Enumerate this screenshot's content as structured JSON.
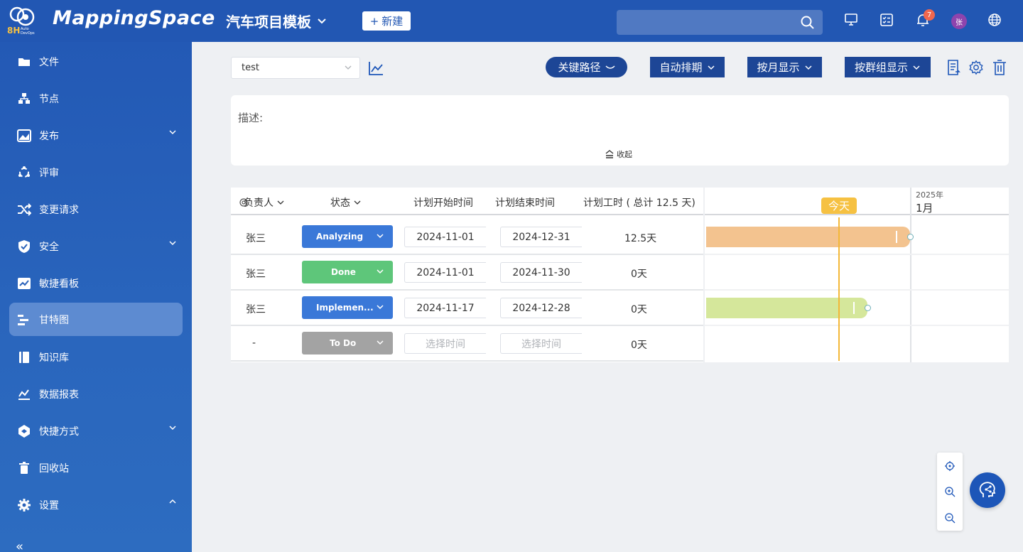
{
  "app": {
    "logo_text": "MappingSpace",
    "logo_sub": "8H",
    "logo_sub2": "Auto DevOps",
    "project_title": "汽车项目模板",
    "new_button": "新建",
    "notification_count": "7",
    "avatar_initial": "张"
  },
  "sidebar": {
    "items": [
      {
        "label": "文件",
        "icon": "folder-icon"
      },
      {
        "label": "节点",
        "icon": "node-icon"
      },
      {
        "label": "发布",
        "icon": "release-icon"
      },
      {
        "label": "评审",
        "icon": "review-icon"
      },
      {
        "label": "变更请求",
        "icon": "shuffle-icon"
      },
      {
        "label": "安全",
        "icon": "shield-icon"
      },
      {
        "label": "敏捷看板",
        "icon": "board-icon"
      },
      {
        "label": "甘特图",
        "icon": "gantt-icon"
      },
      {
        "label": "知识库",
        "icon": "book-icon"
      },
      {
        "label": "数据报表",
        "icon": "chart-icon"
      },
      {
        "label": "快捷方式",
        "icon": "shortcut-icon"
      },
      {
        "label": "回收站",
        "icon": "trash-icon"
      },
      {
        "label": "设置",
        "icon": "gear-icon"
      }
    ],
    "active_index": 7,
    "collapse": "«"
  },
  "toolbar": {
    "selected_chart": "test",
    "critical_path": "关键路径",
    "auto_schedule": "自动排期",
    "by_month": "按月显示",
    "by_group": "按群组显示"
  },
  "description": {
    "label": "描述:",
    "collapse": "收起"
  },
  "table": {
    "headers": {
      "owner": "负责人",
      "status": "状态",
      "plan_start": "计划开始时间",
      "plan_end": "计划结束时间",
      "plan_hours": "计划工时 ( 总计 12.5 天)"
    },
    "rows": [
      {
        "owner": "张三",
        "status": "Analyzing",
        "status_color": "#3a78d8",
        "start": "2024-11-01",
        "end": "2024-12-31",
        "hours": "12.5天"
      },
      {
        "owner": "张三",
        "status": "Done",
        "status_color": "#5ec67a",
        "start": "2024-11-01",
        "end": "2024-11-30",
        "hours": "0天"
      },
      {
        "owner": "张三",
        "status": "Implemen...",
        "status_color": "#3a78d8",
        "start": "2024-11-17",
        "end": "2024-12-28",
        "hours": "0天"
      },
      {
        "owner": "-",
        "status": "To Do",
        "status_color": "#a3a3a3",
        "start_placeholder": "选择时间",
        "end_placeholder": "选择时间",
        "hours": "0天"
      }
    ]
  },
  "gantt": {
    "year": "2025年",
    "month": "1月",
    "today": "今天",
    "bar_colors": [
      "#f3c38f",
      "#d5e79b"
    ]
  }
}
